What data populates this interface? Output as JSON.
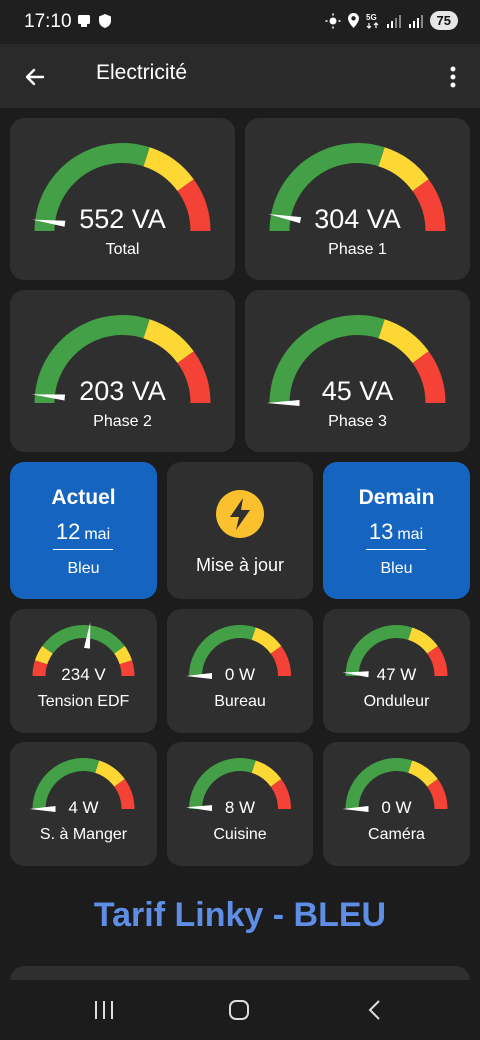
{
  "status_bar": {
    "time": "17:10",
    "battery": "75",
    "left_icons": [
      "device-icon",
      "shield-icon"
    ],
    "right_icons": [
      "brightness-icon",
      "location-icon",
      "5g-icon",
      "signal-icon",
      "signal-icon"
    ]
  },
  "app_bar": {
    "title": "Electricité",
    "back_icon": "arrow-left-icon",
    "menu_icon": "more-vertical-icon"
  },
  "colors": {
    "green": "#43a047",
    "yellow": "#fdd835",
    "red": "#f44336",
    "card": "#2f2f2f",
    "blue_card": "#1565c0",
    "tarif_text": "#5e8ee6"
  },
  "power_gauges": [
    {
      "value": "552 VA",
      "label": "Total",
      "level": 0.04
    },
    {
      "value": "304 VA",
      "label": "Phase 1",
      "level": 0.06
    },
    {
      "value": "203 VA",
      "label": "Phase 2",
      "level": 0.03
    },
    {
      "value": "45 VA",
      "label": "Phase 3",
      "level": 0.0
    }
  ],
  "tempo": {
    "today": {
      "title": "Actuel",
      "day": "12",
      "month": "mai",
      "color": "Bleu"
    },
    "update": {
      "label": "Mise à jour",
      "icon": "lightning-bolt-icon"
    },
    "tomorrow": {
      "title": "Demain",
      "day": "13",
      "month": "mai",
      "color": "Bleu"
    }
  },
  "small_gauges": [
    {
      "value": "234 V",
      "label": "Tension EDF",
      "level": 0.54,
      "bands": [
        [
          "red",
          0,
          0.1
        ],
        [
          "yellow",
          0.1,
          0.2
        ],
        [
          "green",
          0.2,
          0.8
        ],
        [
          "yellow",
          0.8,
          0.9
        ],
        [
          "red",
          0.9,
          1
        ]
      ]
    },
    {
      "value": "0 W",
      "label": "Bureau",
      "level": 0.0
    },
    {
      "value": "47 W",
      "label": "Onduleur",
      "level": 0.02
    },
    {
      "value": "4 W",
      "label": "S. à Manger",
      "level": 0.0
    },
    {
      "value": "8 W",
      "label": "Cuisine",
      "level": 0.01
    },
    {
      "value": "0 W",
      "label": "Caméra",
      "level": 0.0
    }
  ],
  "tarif_title": "Tarif Linky - BLEU",
  "nav_bar": {
    "recent_icon": "recent-apps-icon",
    "home_icon": "home-icon",
    "back_icon": "back-chevron-icon"
  }
}
